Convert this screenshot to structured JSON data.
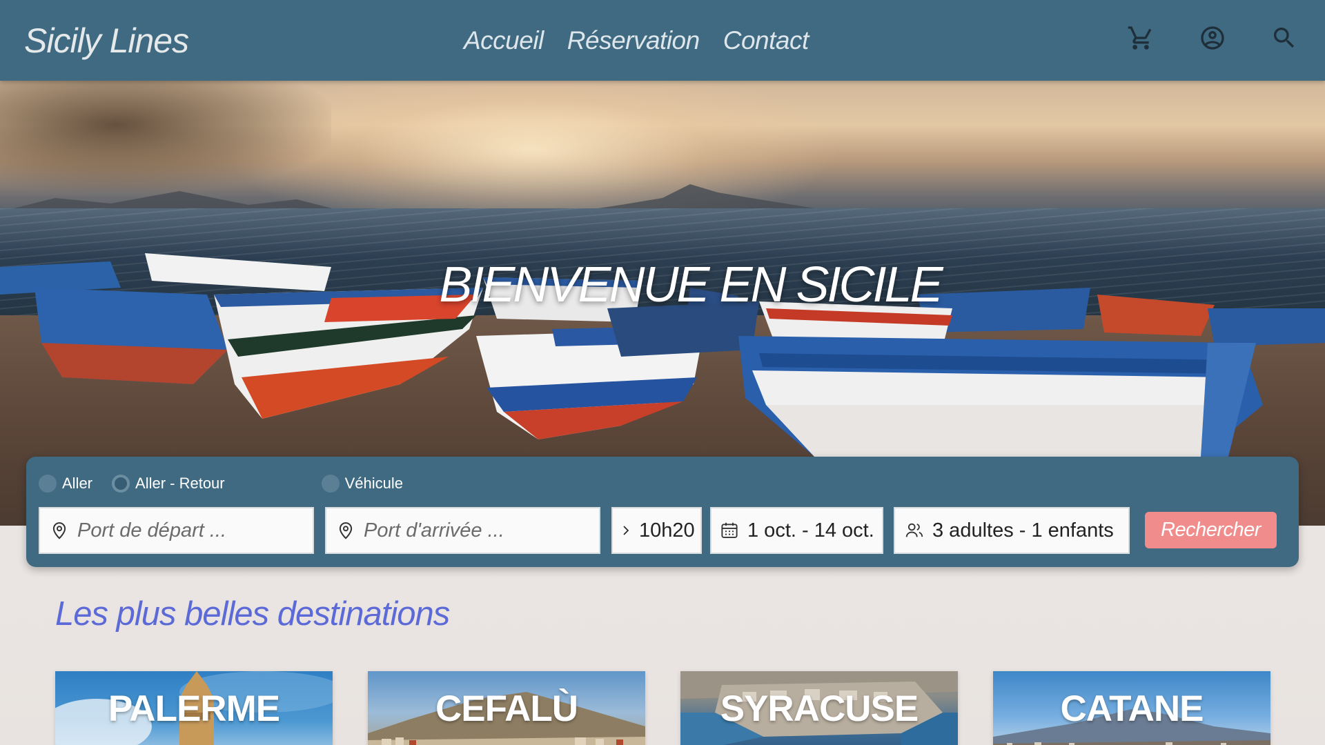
{
  "header": {
    "brand": "Sicily Lines",
    "nav": [
      {
        "label": "Accueil"
      },
      {
        "label": "Réservation"
      },
      {
        "label": "Contact"
      }
    ],
    "icons": [
      "cart-icon",
      "account-icon",
      "search-icon"
    ]
  },
  "hero": {
    "title": "BIENVENUE EN SICILE"
  },
  "search": {
    "trip_types": [
      {
        "label": "Aller",
        "selected": false
      },
      {
        "label": "Aller - Retour",
        "selected": true
      },
      {
        "label": "Véhicule",
        "selected": false
      }
    ],
    "departure_placeholder": "Port de départ ...",
    "arrival_placeholder": "Port d'arrivée ...",
    "time": "10h20",
    "dates": "1 oct. - 14 oct.",
    "passengers": "3 adultes - 1 enfants",
    "submit_label": "Rechercher"
  },
  "destinations": {
    "title": "Les plus belles destinations",
    "items": [
      {
        "name": "PALERME"
      },
      {
        "name": "CEFALÙ"
      },
      {
        "name": "SYRACUSE"
      },
      {
        "name": "CATANE"
      }
    ]
  },
  "colors": {
    "header_bg": "#3f6a82",
    "panel_bg": "#3f6a82",
    "accent_button": "#f08c8c",
    "section_title": "#5b6ad6"
  }
}
